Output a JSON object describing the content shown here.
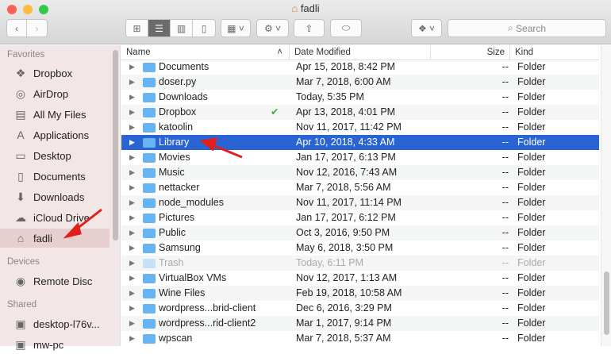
{
  "window": {
    "title": "fadli"
  },
  "toolbar": {
    "search_placeholder": "Search"
  },
  "sidebar": {
    "favorites_label": "Favorites",
    "favorites": [
      {
        "label": "Dropbox",
        "icon": "dropbox-icon"
      },
      {
        "label": "AirDrop",
        "icon": "airdrop-icon"
      },
      {
        "label": "All My Files",
        "icon": "all-files-icon"
      },
      {
        "label": "Applications",
        "icon": "applications-icon"
      },
      {
        "label": "Desktop",
        "icon": "desktop-icon"
      },
      {
        "label": "Documents",
        "icon": "documents-icon"
      },
      {
        "label": "Downloads",
        "icon": "downloads-icon"
      },
      {
        "label": "iCloud Drive",
        "icon": "icloud-icon"
      },
      {
        "label": "fadli",
        "icon": "home-icon"
      }
    ],
    "devices_label": "Devices",
    "devices": [
      {
        "label": "Remote Disc"
      }
    ],
    "shared_label": "Shared",
    "shared": [
      {
        "label": "desktop-l76v..."
      },
      {
        "label": "mw-pc"
      }
    ]
  },
  "columns": {
    "name": "Name",
    "date": "Date Modified",
    "size": "Size",
    "kind": "Kind"
  },
  "files": [
    {
      "name": "Documents",
      "date": "Apr 15, 2018, 8:42 PM",
      "size": "--",
      "kind": "Folder"
    },
    {
      "name": "doser.py",
      "date": "Mar 7, 2018, 6:00 AM",
      "size": "--",
      "kind": "Folder"
    },
    {
      "name": "Downloads",
      "date": "Today, 5:35 PM",
      "size": "--",
      "kind": "Folder"
    },
    {
      "name": "Dropbox",
      "date": "Apr 13, 2018, 4:01 PM",
      "size": "--",
      "kind": "Folder"
    },
    {
      "name": "katoolin",
      "date": "Nov 11, 2017, 11:42 PM",
      "size": "--",
      "kind": "Folder"
    },
    {
      "name": "Library",
      "date": "Apr 10, 2018, 4:33 AM",
      "size": "--",
      "kind": "Folder"
    },
    {
      "name": "Movies",
      "date": "Jan 17, 2017, 6:13 PM",
      "size": "--",
      "kind": "Folder"
    },
    {
      "name": "Music",
      "date": "Nov 12, 2016, 7:43 AM",
      "size": "--",
      "kind": "Folder"
    },
    {
      "name": "nettacker",
      "date": "Mar 7, 2018, 5:56 AM",
      "size": "--",
      "kind": "Folder"
    },
    {
      "name": "node_modules",
      "date": "Nov 11, 2017, 11:14 PM",
      "size": "--",
      "kind": "Folder"
    },
    {
      "name": "Pictures",
      "date": "Jan 17, 2017, 6:12 PM",
      "size": "--",
      "kind": "Folder"
    },
    {
      "name": "Public",
      "date": "Oct 3, 2016, 9:50 PM",
      "size": "--",
      "kind": "Folder"
    },
    {
      "name": "Samsung",
      "date": "May 6, 2018, 3:50 PM",
      "size": "--",
      "kind": "Folder"
    },
    {
      "name": "Trash",
      "date": "Today, 6:11 PM",
      "size": "--",
      "kind": "Folder"
    },
    {
      "name": "VirtualBox VMs",
      "date": "Nov 12, 2017, 1:13 AM",
      "size": "--",
      "kind": "Folder"
    },
    {
      "name": "Wine Files",
      "date": "Feb 19, 2018, 10:58 AM",
      "size": "--",
      "kind": "Folder"
    },
    {
      "name": "wordpress...brid-client",
      "date": "Dec 6, 2016, 3:29 PM",
      "size": "--",
      "kind": "Folder"
    },
    {
      "name": "wordpress...rid-client2",
      "date": "Mar 1, 2017, 9:14 PM",
      "size": "--",
      "kind": "Folder"
    },
    {
      "name": "wpscan",
      "date": "Mar 7, 2018, 5:37 AM",
      "size": "--",
      "kind": "Folder"
    }
  ],
  "selected": "Library"
}
